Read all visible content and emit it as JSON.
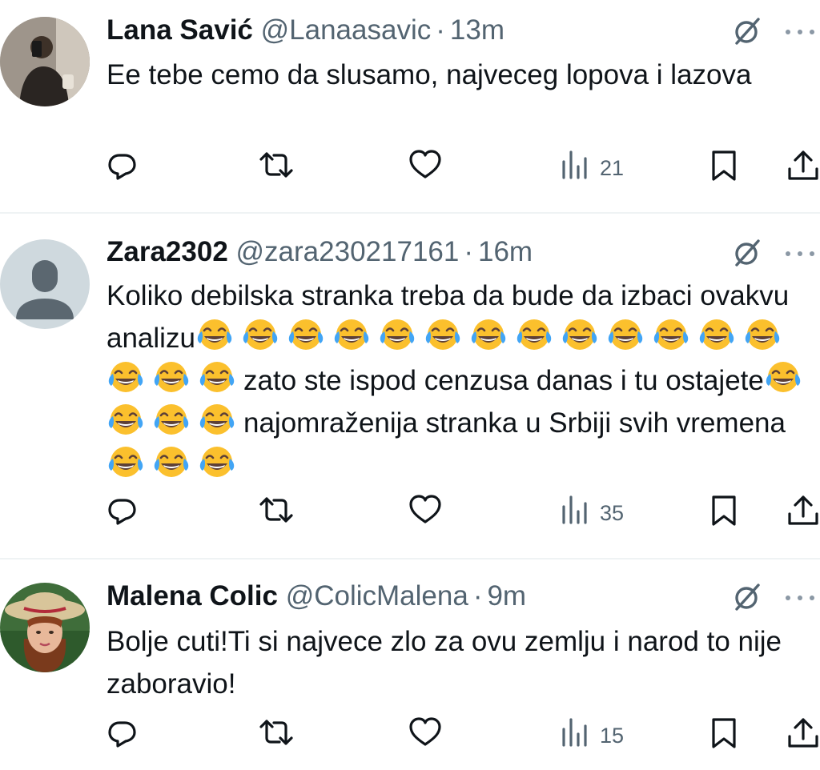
{
  "tweets": [
    {
      "name": "Lana Savić",
      "handle": "@Lanaasavic",
      "dot": "·",
      "time": "13m",
      "text": "Ee tebe cemo da slusamo, najveceg lopova i lazova",
      "views": "21",
      "avatar": "photo-avatar"
    },
    {
      "name": "Zara2302",
      "handle": "@zara230217161",
      "dot": "·",
      "time": "16m",
      "text_parts": [
        "Koliko debilska stranka treba da bude da izbaci ovakvu analizu",
        "zato ste ispod cenzusa danas i tu ostajete",
        "najomraženija stranka u Srbiji svih vremena"
      ],
      "emoji_groups": [
        16,
        4,
        3
      ],
      "emoji": "😂",
      "views": "35",
      "avatar": "default-avatar"
    },
    {
      "name": "Malena Colic",
      "handle": "@ColicMalena",
      "dot": "·",
      "time": "9m",
      "text": "Bolje cuti!Ti si najvece zlo za ovu zemlju i narod to nije zaboravio!",
      "views": "15",
      "avatar": "photo-avatar"
    }
  ],
  "colors": {
    "text": "#0f1419",
    "secondary": "#536471",
    "divider": "#eff3f4",
    "default_avatar_bg": "#cfd9de",
    "default_avatar_fg": "#5b6770"
  },
  "icons": {
    "header": [
      "grok-icon",
      "more-icon"
    ],
    "actions": [
      "reply-icon",
      "retweet-icon",
      "like-icon",
      "views-icon",
      "bookmark-icon",
      "share-icon"
    ]
  }
}
